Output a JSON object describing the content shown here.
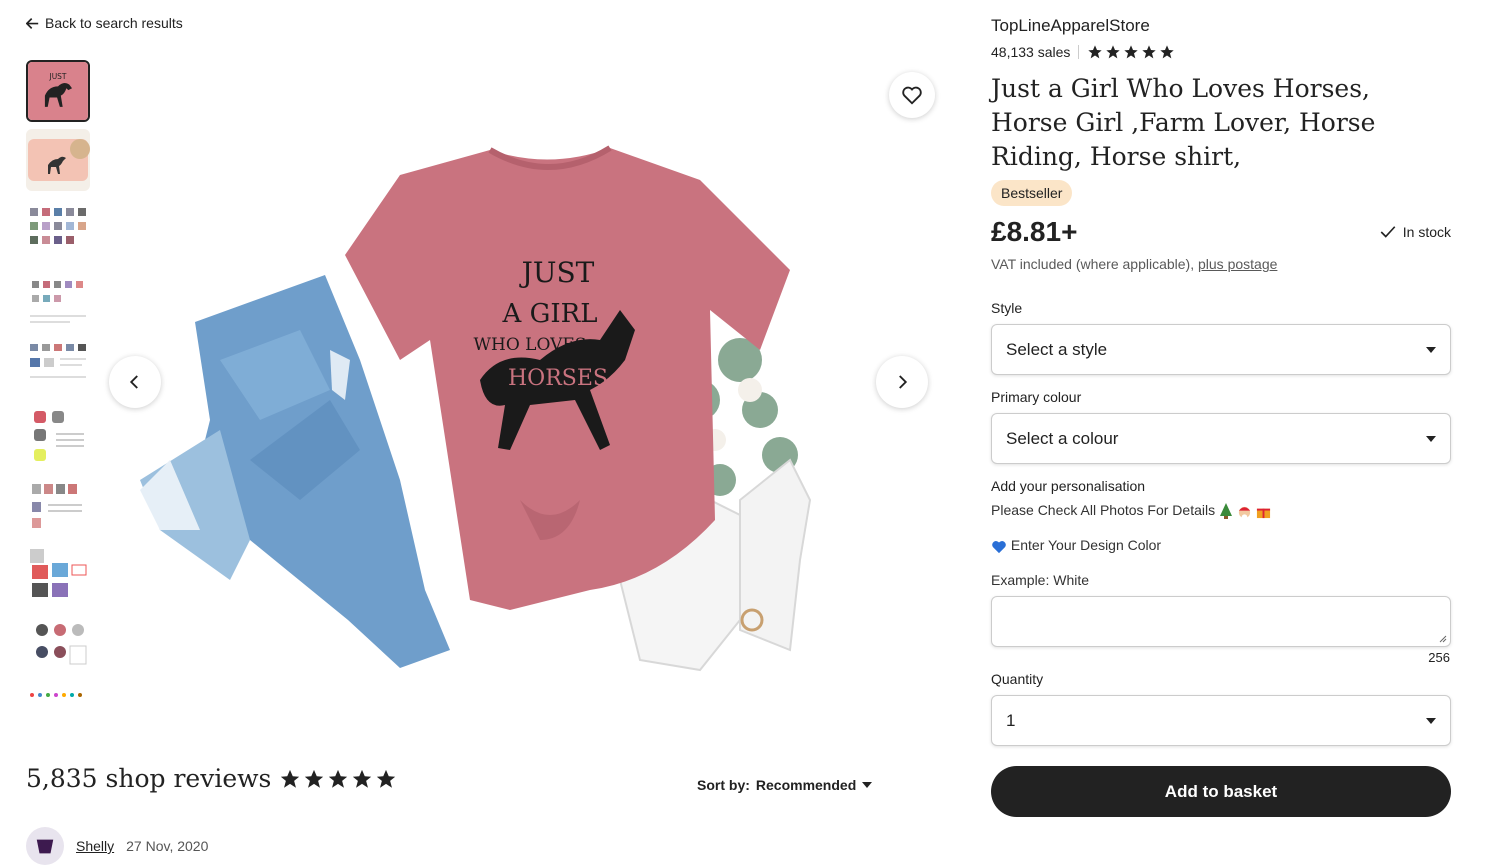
{
  "nav": {
    "back_label": "Back to search results"
  },
  "shop": {
    "name": "TopLineApparelStore",
    "sales": "48,133 sales",
    "rating": 5
  },
  "product": {
    "title": "Just a Girl Who Loves Horses, Horse Girl ,Farm Lover, Horse Riding, Horse shirt,",
    "badge": "Bestseller",
    "price": "£8.81+",
    "stock": "In stock",
    "vat_text": "VAT included (where applicable),",
    "postage_link": "plus postage"
  },
  "image": {
    "shirt_text": [
      "JUST",
      "A GIRL",
      "WHO LOVES",
      "HORSES"
    ],
    "shirt_color": "#c9737f",
    "jeans_color": "#6f9ecb"
  },
  "thumbnails": {
    "count": 10,
    "active_index": 0
  },
  "options": {
    "style_label": "Style",
    "style_value": "Select a style",
    "colour_label": "Primary colour",
    "colour_value": "Select a colour",
    "personalisation_label": "Add your personalisation",
    "personalisation_line1": "Please Check All Photos For Details",
    "personalisation_line2": "Enter Your Design Color",
    "personalisation_line3": "Example: White",
    "personalisation_value": "",
    "char_counter": "256",
    "quantity_label": "Quantity",
    "quantity_value": "1"
  },
  "actions": {
    "add_to_basket": "Add to basket"
  },
  "reviews": {
    "count_text": "5,835 shop reviews",
    "rating": 5,
    "sort_label": "Sort by:",
    "sort_value": "Recommended",
    "first_reviewer": "Shelly",
    "first_date": "27 Nov, 2020"
  },
  "colors": {
    "text": "#222222",
    "badge_bg": "#fbe5c8",
    "button_bg": "#222222",
    "muted": "#595959"
  }
}
